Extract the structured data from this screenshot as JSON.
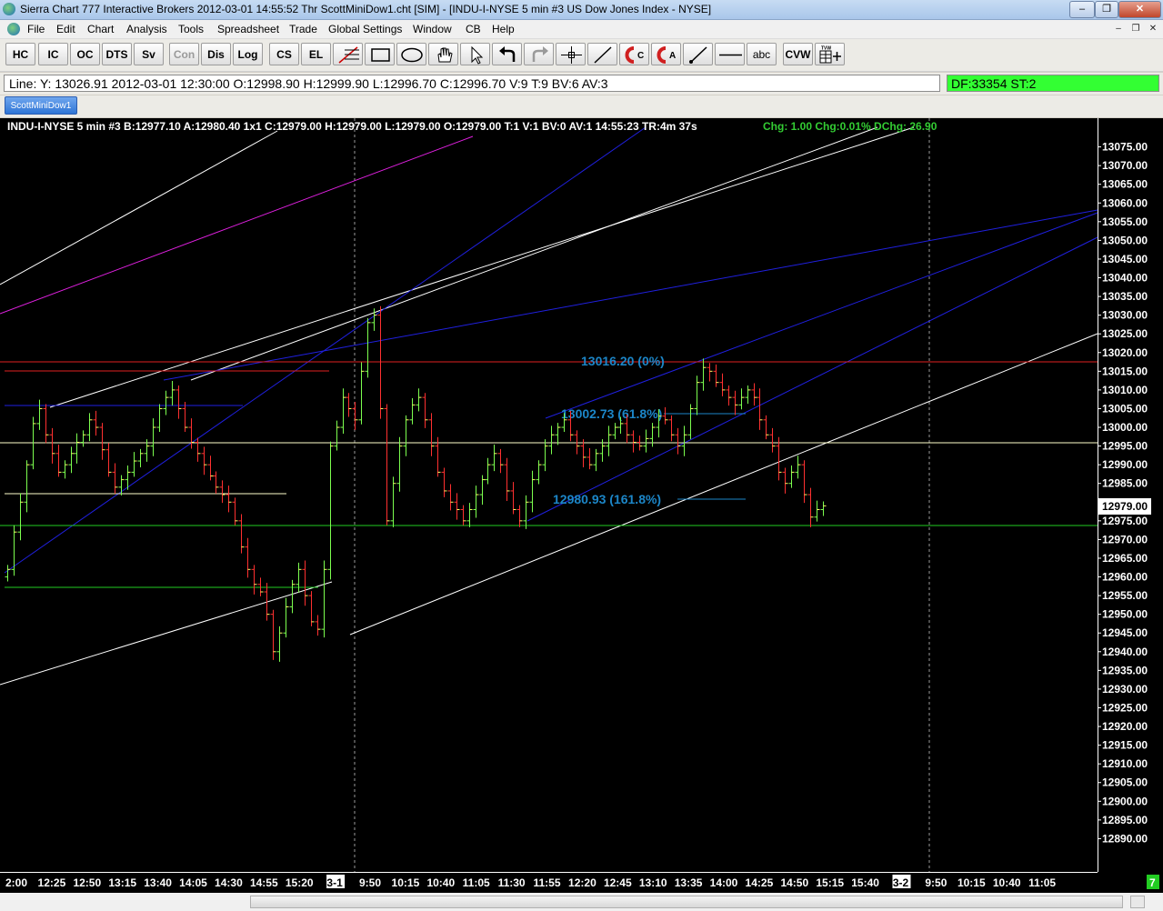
{
  "window": {
    "title": "Sierra Chart 777 Interactive Brokers 2012-03-01  14:55:52 Thr  ScottMiniDow1.cht [SIM] - [INDU-I-NYSE  5 min  #3  US Dow Jones Index - NYSE]",
    "min_glyph": "–",
    "max_glyph": "❐",
    "close_glyph": "✕"
  },
  "menu": {
    "items": [
      "File",
      "Edit",
      "Chart",
      "Analysis",
      "Tools",
      "Spreadsheet",
      "Trade",
      "Global Settings",
      "Window",
      "CB",
      "Help"
    ],
    "mdi_min": "–",
    "mdi_restore": "❐",
    "mdi_close": "✕"
  },
  "toolbar": {
    "text_buttons": [
      "HC",
      "IC",
      "OC",
      "DTS",
      "Sv",
      "Con",
      "Dis",
      "Log",
      "CS",
      "EL"
    ],
    "abc_label": "abc",
    "cvw_label": "CVW",
    "icons": [
      "fibonacci-icon",
      "rectangle-icon",
      "ellipse-icon",
      "hand-icon",
      "pointer-icon",
      "undo-icon",
      "redo-icon",
      "crosshair-icon",
      "line-icon",
      "magnet-c-icon",
      "magnet-a-icon",
      "ray-icon",
      "horizontal-line-icon",
      "tvw-icon"
    ]
  },
  "infobar": {
    "line": "Line: Y: 13026.91  2012-03-01  12:30:00  O:12998.90  H:12999.90  L:12996.70  C:12996.70  V:9  T:9  BV:6  AV:3",
    "df": "DF:33354  ST:2"
  },
  "chartbook": {
    "tab": "ScottMiniDow1"
  },
  "chart": {
    "header_main": "INDU-I-NYSE  5 min  #3 B:12977.10 A:12980.40 1x1 C:12979.00 H:12979.00 L:12979.00 O:12979.00 T:1 V:1 BV:0 AV:1 14:55:23 TR:4m 37s",
    "header_chg": "Chg: 1.00 Chg:0.01% DChg: 26.90",
    "last_price_label": "12979.00",
    "fib_labels": [
      "13016.20 (0%)",
      "13002.73 (61.8%)",
      "12980.93 (161.8%)"
    ],
    "corner_marker": "7",
    "colors": {
      "background": "#000000",
      "up_bar": "#7cff4f",
      "down_bar": "#ff3030",
      "blue_line": "#2020e0",
      "magenta_line": "#e020e0",
      "fib_label": "#1c86c8",
      "header_chg": "#33cc33"
    }
  },
  "chart_data": {
    "type": "ohlc",
    "instrument": "INDU-I-NYSE",
    "interval": "5 min",
    "ylim": [
      12885,
      13080
    ],
    "y_ticks": [
      "13075.00",
      "13070.00",
      "13065.00",
      "13060.00",
      "13055.00",
      "13050.00",
      "13045.00",
      "13040.00",
      "13035.00",
      "13030.00",
      "13025.00",
      "13020.00",
      "13015.00",
      "13010.00",
      "13005.00",
      "13000.00",
      "12995.00",
      "12990.00",
      "12985.00",
      "12980.00",
      "12975.00",
      "12970.00",
      "12965.00",
      "12960.00",
      "12955.00",
      "12950.00",
      "12945.00",
      "12940.00",
      "12935.00",
      "12930.00",
      "12925.00",
      "12920.00",
      "12915.00",
      "12910.00",
      "12905.00",
      "12900.00",
      "12895.00",
      "12890.00"
    ],
    "x_ticks": [
      "2:00",
      "12:25",
      "12:50",
      "13:15",
      "13:40",
      "14:05",
      "14:30",
      "14:55",
      "15:20",
      "3-1",
      "9:50",
      "10:15",
      "10:40",
      "11:05",
      "11:30",
      "11:55",
      "12:20",
      "12:45",
      "13:10",
      "13:35",
      "14:00",
      "14:25",
      "14:50",
      "15:15",
      "15:40",
      "3-2",
      "9:50",
      "10:15",
      "10:40",
      "11:05"
    ],
    "day_separators": [
      "3-1",
      "3-2"
    ],
    "grid": false,
    "legend": "none",
    "series": [
      {
        "name": "INDU-I-NYSE",
        "keypoints": [
          12962,
          12972,
          12980,
          12990,
          13001,
          13005,
          12998,
          12993,
          12988,
          12990,
          12993,
          12996,
          12998,
          13002,
          13000,
          12994,
          12988,
          12984,
          12986,
          12988,
          12991,
          12993,
          12995,
          13000,
          13005,
          13008,
          13010,
          13005,
          13000,
          12996,
          12993,
          12990,
          12987,
          12984,
          12982,
          12980,
          12975,
          12968,
          12962,
          12958,
          12956,
          12950,
          12940,
          12945,
          12952,
          12958,
          12962,
          12955,
          12948,
          12946,
          12962,
          12995,
          13000,
          13008,
          13005,
          13002,
          13015,
          13028,
          13030,
          13005,
          12975,
          12985,
          12995,
          13002,
          13006,
          13008,
          13002,
          12995,
          12988,
          12983,
          12980,
          12978,
          12975,
          12978,
          12982,
          12986,
          12990,
          12993,
          12990,
          12983,
          12978,
          12975,
          12980,
          12986,
          12990,
          12995,
          12998,
          13000,
          13002,
          12998,
          12995,
          12992,
          12990,
          12993,
          12995,
          12998,
          13000,
          13001,
          12998,
          12996,
          12995,
          12997,
          13000,
          13003,
          13002,
          12998,
          12995,
          12998,
          13005,
          13012,
          13016,
          13015,
          13012,
          13010,
          13008,
          13006,
          13008,
          13010,
          13008,
          13002,
          12998,
          12995,
          12988,
          12985,
          12988,
          12990,
          12982,
          12976,
          12978,
          12979
        ]
      }
    ]
  }
}
